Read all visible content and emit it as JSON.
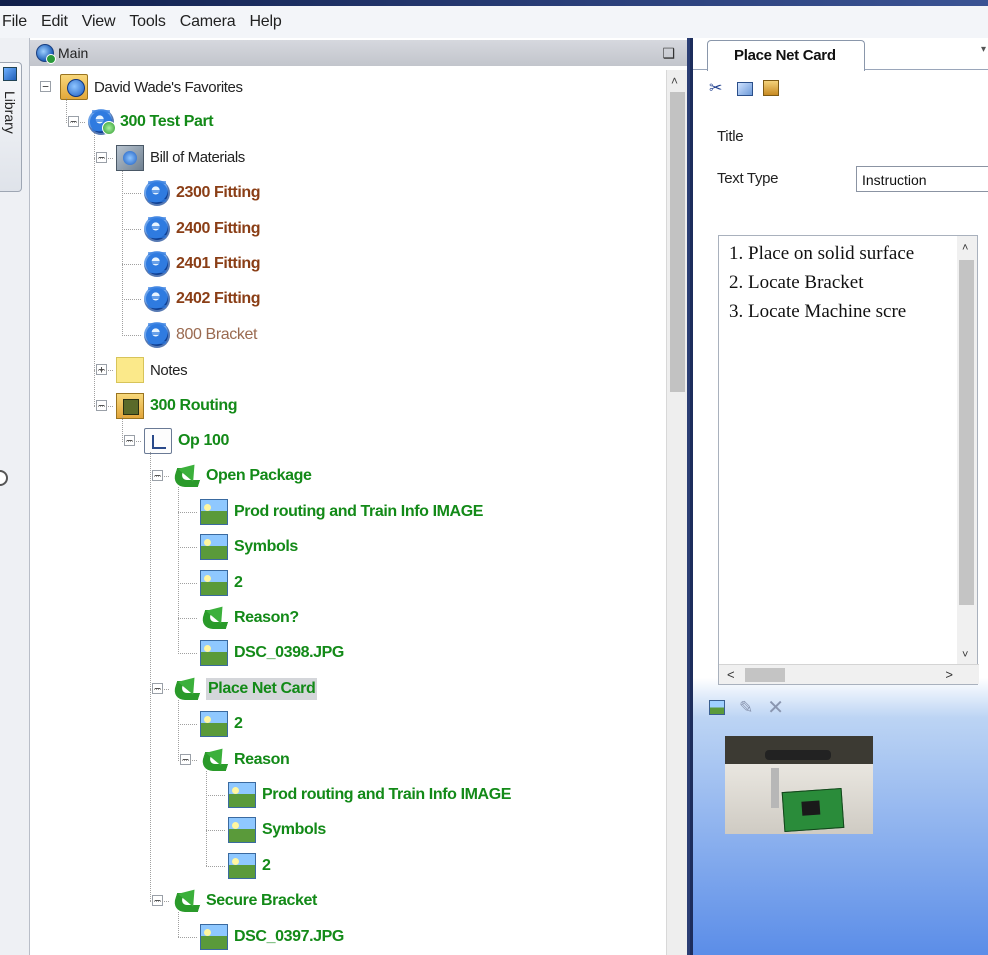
{
  "menu": [
    "File",
    "Edit",
    "View",
    "Tools",
    "Camera",
    "Help"
  ],
  "library_tab": "Library",
  "main_panel": {
    "title": "Main",
    "pin": "❑"
  },
  "tree": [
    {
      "label": "David Wade's Favorites",
      "style": "plain",
      "icon": "favorites",
      "level": 0,
      "expander": "−"
    },
    {
      "label": "300 Test Part",
      "style": "green",
      "icon": "gear-green",
      "level": 1,
      "expander": "−"
    },
    {
      "label": "Bill of Materials",
      "style": "plain",
      "icon": "bom",
      "level": 2,
      "expander": "−"
    },
    {
      "label": "2300 Fitting",
      "style": "brown",
      "icon": "gear",
      "level": 3,
      "expander": ""
    },
    {
      "label": "2400 Fitting",
      "style": "brown",
      "icon": "gear",
      "level": 3,
      "expander": ""
    },
    {
      "label": "2401 Fitting",
      "style": "brown",
      "icon": "gear",
      "level": 3,
      "expander": ""
    },
    {
      "label": "2402 Fitting",
      "style": "brown",
      "icon": "gear",
      "level": 3,
      "expander": ""
    },
    {
      "label": "800 Bracket",
      "style": "faded",
      "icon": "gear",
      "level": 3,
      "expander": ""
    },
    {
      "label": "Notes",
      "style": "plain",
      "icon": "notes",
      "level": 2,
      "expander": "+"
    },
    {
      "label": "300 Routing",
      "style": "green",
      "icon": "routing",
      "level": 2,
      "expander": "−"
    },
    {
      "label": "Op 100",
      "style": "green",
      "icon": "op",
      "level": 3,
      "expander": "−"
    },
    {
      "label": "Open Package",
      "style": "green",
      "icon": "arrow",
      "level": 4,
      "expander": "−"
    },
    {
      "label": "Prod routing and Train Info IMAGE",
      "style": "green",
      "icon": "image",
      "level": 5,
      "expander": ""
    },
    {
      "label": "Symbols",
      "style": "green",
      "icon": "image",
      "level": 5,
      "expander": ""
    },
    {
      "label": "2",
      "style": "green",
      "icon": "image",
      "level": 5,
      "expander": ""
    },
    {
      "label": "Reason?",
      "style": "green",
      "icon": "arrow",
      "level": 5,
      "expander": ""
    },
    {
      "label": "DSC_0398.JPG",
      "style": "green",
      "icon": "image",
      "level": 5,
      "expander": ""
    },
    {
      "label": "Place Net Card",
      "style": "green",
      "icon": "arrow",
      "level": 4,
      "expander": "−",
      "selected": true
    },
    {
      "label": "2",
      "style": "green",
      "icon": "image",
      "level": 5,
      "expander": ""
    },
    {
      "label": "Reason",
      "style": "green",
      "icon": "arrow",
      "level": 5,
      "expander": "−"
    },
    {
      "label": "Prod routing and Train Info IMAGE",
      "style": "green",
      "icon": "image",
      "level": 6,
      "expander": ""
    },
    {
      "label": "Symbols",
      "style": "green",
      "icon": "image",
      "level": 6,
      "expander": ""
    },
    {
      "label": "2",
      "style": "green",
      "icon": "image",
      "level": 6,
      "expander": ""
    },
    {
      "label": "Secure Bracket",
      "style": "green",
      "icon": "arrow",
      "level": 4,
      "expander": "−"
    },
    {
      "label": "DSC_0397.JPG",
      "style": "green",
      "icon": "image",
      "level": 5,
      "expander": ""
    }
  ],
  "right_panel": {
    "tab_label": "Place Net Card",
    "tab_dropdown": "▾",
    "toolbar": [
      "cut-icon",
      "copy-icon",
      "paste-icon"
    ],
    "title_label": "Title",
    "text_type_label": "Text Type",
    "text_type_value": "Instruction",
    "instructions": [
      "1. Place on solid surface",
      "2. Locate Bracket",
      "3. Locate Machine scre"
    ],
    "scroll_up": "˄",
    "scroll_down": "˅",
    "scroll_left": "<",
    "scroll_right": ">",
    "image_toolbar": [
      "insert-image-icon",
      "edit-pencil-icon",
      "delete-icon"
    ]
  }
}
